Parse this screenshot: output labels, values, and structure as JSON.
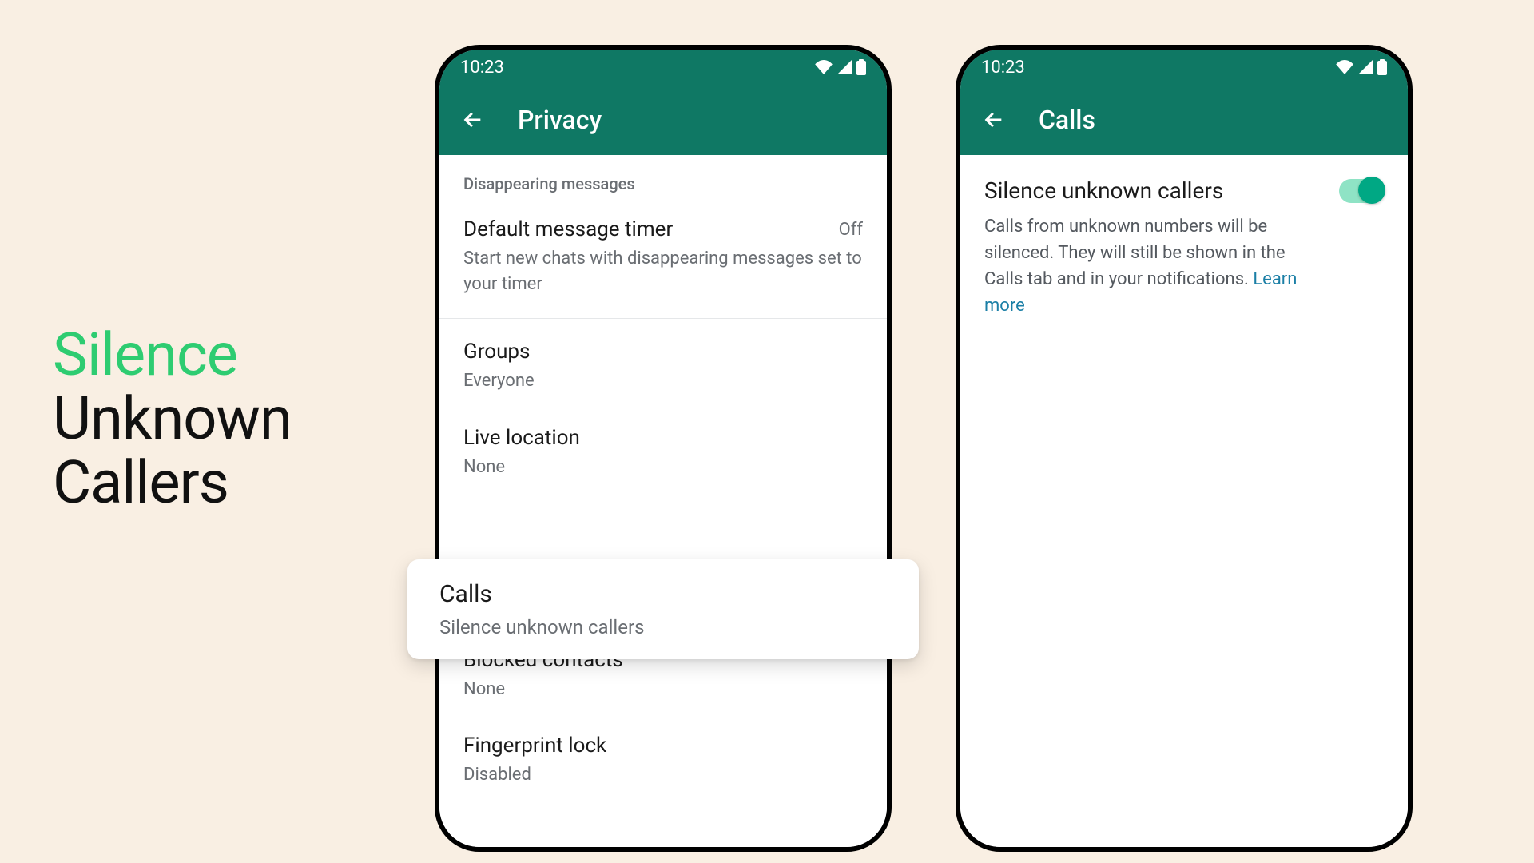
{
  "hero": {
    "accent": "Silence",
    "line2": "Unknown",
    "line3": "Callers"
  },
  "status": {
    "time": "10:23"
  },
  "phone_left": {
    "app_bar_title": "Privacy",
    "section_header": "Disappearing messages",
    "default_timer": {
      "title": "Default message timer",
      "value": "Off",
      "subtitle": "Start new chats with disappearing messages set to your timer"
    },
    "groups": {
      "title": "Groups",
      "subtitle": "Everyone"
    },
    "live_location": {
      "title": "Live location",
      "subtitle": "None"
    },
    "calls_card": {
      "title": "Calls",
      "subtitle": "Silence unknown callers"
    },
    "blocked": {
      "title": "Blocked contacts",
      "subtitle": "None"
    },
    "fingerprint": {
      "title": "Fingerprint lock",
      "subtitle": "Disabled"
    }
  },
  "phone_right": {
    "app_bar_title": "Calls",
    "setting": {
      "title": "Silence unknown callers",
      "desc": "Calls from unknown numbers will be silenced. They will still be shown in the Calls tab and in your notifications. ",
      "link": "Learn more"
    }
  }
}
